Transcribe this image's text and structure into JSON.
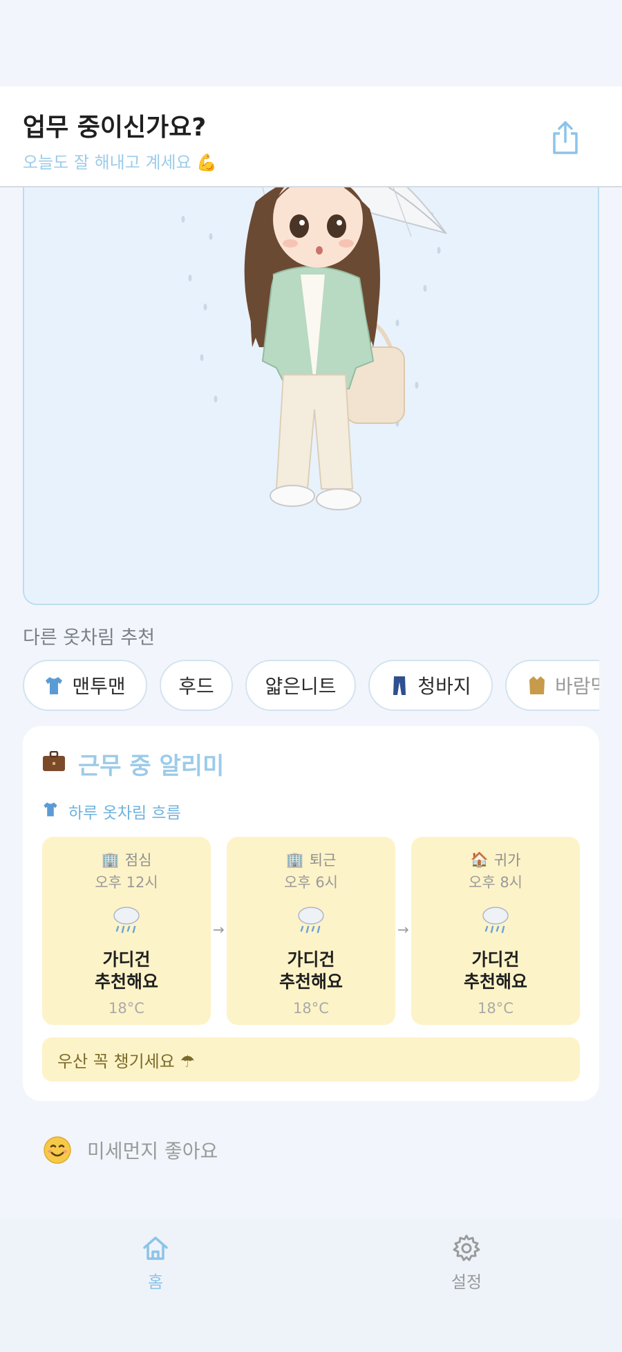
{
  "header": {
    "title": "업무 중이신가요?",
    "subtitle": "오늘도 잘 해내고 계세요 💪"
  },
  "icons": {
    "share": "share-icon",
    "briefcase": "briefcase-icon",
    "shirt": "shirt-icon",
    "cloud_rain": "cloud-rain-icon",
    "home": "home-icon",
    "settings": "gear-icon"
  },
  "outfits": {
    "label": "다른 옷차림 추천",
    "chips": [
      {
        "label": "맨투맨",
        "icon": "shirt-icon"
      },
      {
        "label": "후드",
        "icon": ""
      },
      {
        "label": "얇은니트",
        "icon": ""
      },
      {
        "label": "청바지",
        "icon": "jeans-icon"
      },
      {
        "label": "바람막이",
        "icon": "coat-icon"
      }
    ]
  },
  "work": {
    "title": "근무 중 알리미",
    "flow_label": "하루 옷차림 흐름",
    "slots": [
      {
        "icon": "🏢",
        "name": "점심",
        "time": "오후 12시",
        "line1": "가디건",
        "line2": "추천해요",
        "temp": "18°C"
      },
      {
        "icon": "🏢",
        "name": "퇴근",
        "time": "오후 6시",
        "line1": "가디건",
        "line2": "추천해요",
        "temp": "18°C"
      },
      {
        "icon": "🏠",
        "name": "귀가",
        "time": "오후 8시",
        "line1": "가디건",
        "line2": "추천해요",
        "temp": "18°C"
      }
    ],
    "arrow": "→",
    "umbrella_note": "우산 꼭 챙기세요 ☂"
  },
  "dust": {
    "label": "미세먼지 좋아요"
  },
  "nav": {
    "home": "홈",
    "settings": "설정"
  },
  "colors": {
    "accent": "#9ccbe9",
    "card_yellow": "#fdf3c8",
    "background": "#f2f6fc"
  }
}
